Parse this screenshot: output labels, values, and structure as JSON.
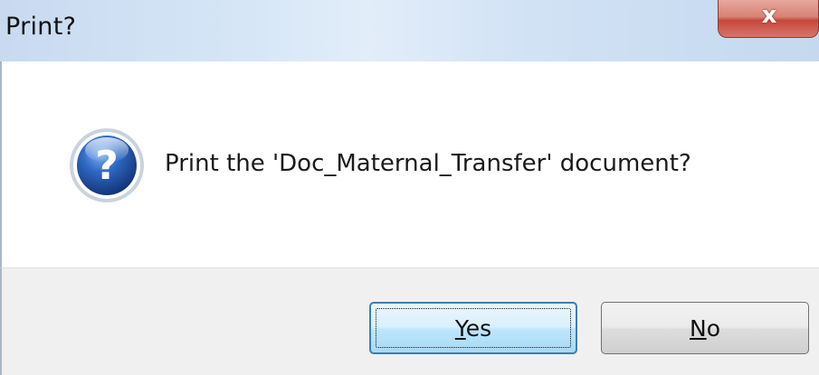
{
  "window": {
    "title": "Print?",
    "close_glyph": "x"
  },
  "content": {
    "icon": "question-icon",
    "message": "Print the 'Doc_Maternal_Transfer' document?"
  },
  "buttons": {
    "yes": {
      "mnemonic": "Y",
      "rest": "es"
    },
    "no": {
      "mnemonic": "N",
      "rest": "o"
    }
  },
  "colors": {
    "icon_blue": "#1f4fa3",
    "focus_border": "#3c7fb1",
    "footer_bg": "#f0f0f0",
    "close_red": "#c7473a"
  }
}
